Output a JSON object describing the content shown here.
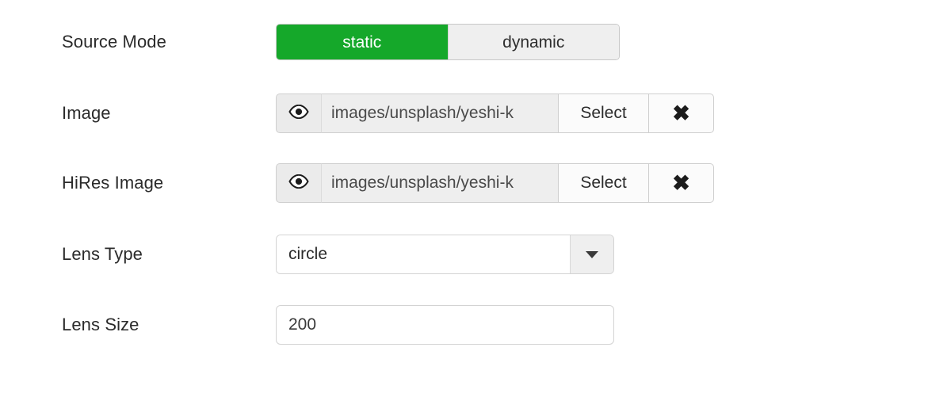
{
  "form": {
    "rows": [
      {
        "label": "Source Mode",
        "type": "segmented",
        "options": [
          "static",
          "dynamic"
        ],
        "selected": "static",
        "active_color": "#15a82a"
      },
      {
        "label": "Image",
        "type": "file-picker",
        "preview_icon": "eye-icon",
        "value": "images/unsplash/yeshi-k",
        "placeholder": "",
        "select_label": "Select",
        "clear_icon": "close-icon",
        "clear_glyph": "✖"
      },
      {
        "label": "HiRes Image",
        "type": "file-picker",
        "preview_icon": "eye-icon",
        "value": "images/unsplash/yeshi-k",
        "placeholder": "",
        "select_label": "Select",
        "clear_icon": "close-icon",
        "clear_glyph": "✖"
      },
      {
        "label": "Lens Type",
        "type": "dropdown",
        "value": "circle",
        "arrow_icon": "chevron-down-icon"
      },
      {
        "label": "Lens Size",
        "type": "number",
        "value": "200",
        "placeholder": ""
      }
    ]
  }
}
